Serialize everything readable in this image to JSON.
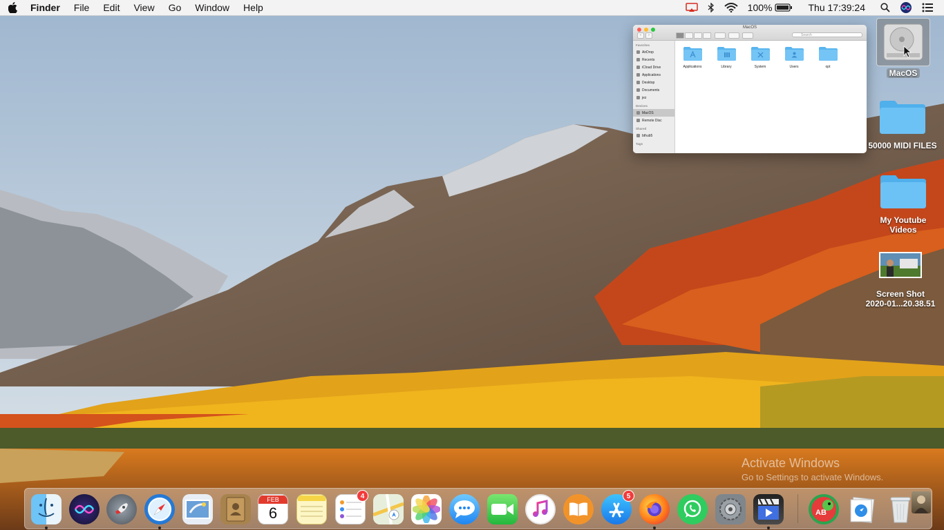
{
  "menubar": {
    "apple_icon": "apple-logo",
    "app_name": "Finder",
    "menus": [
      "File",
      "Edit",
      "View",
      "Go",
      "Window",
      "Help"
    ],
    "battery": "100%",
    "clock": "Thu 17:39:24",
    "status_icons": [
      "airplay-icon",
      "bluetooth-icon",
      "wifi-icon",
      "battery-icon",
      "spotlight-search-icon",
      "siri-icon"
    ]
  },
  "finder_window": {
    "title": "MacOS",
    "search_placeholder": "Search",
    "sidebar": {
      "favorites_header": "Favorites",
      "favorites": [
        "AirDrop",
        "Recents",
        "iCloud Drive",
        "Applications",
        "Desktop",
        "Documents",
        "jez"
      ],
      "devices_header": "Devices",
      "devices": [
        "MacOS",
        "Remote Disc"
      ],
      "shared_header": "Shared",
      "shared": [
        "bthub5"
      ],
      "tags_header": "Tags"
    },
    "items": [
      "Applications",
      "Library",
      "System",
      "Users",
      "opt"
    ]
  },
  "desktop": {
    "icons": [
      {
        "label": "MacOS",
        "icon": "hard-drive-icon"
      },
      {
        "label": "50000 MIDI FILES",
        "icon": "folder-icon"
      },
      {
        "label_line1": "My Youtube",
        "label_line2": "Videos",
        "icon": "folder-icon"
      },
      {
        "label_line1": "Screen Shot",
        "label_line2": "2020-01...20.38.51",
        "icon": "screenshot-thumbnail-icon"
      }
    ]
  },
  "watermark": {
    "line1": "Activate Windows",
    "line2": "Go to Settings to activate Windows."
  },
  "dock": {
    "apps": [
      {
        "name": "Finder",
        "icon": "finder-icon",
        "running": true
      },
      {
        "name": "Siri",
        "icon": "siri-icon"
      },
      {
        "name": "Launchpad",
        "icon": "launchpad-icon"
      },
      {
        "name": "Safari",
        "icon": "safari-icon",
        "running": true
      },
      {
        "name": "Mail",
        "icon": "mail-icon"
      },
      {
        "name": "Contacts",
        "icon": "contacts-icon"
      },
      {
        "name": "Calendar",
        "icon": "calendar-icon",
        "month": "FEB",
        "day": "6"
      },
      {
        "name": "Notes",
        "icon": "notes-icon"
      },
      {
        "name": "Reminders",
        "icon": "reminders-icon",
        "badge": "4"
      },
      {
        "name": "Maps",
        "icon": "maps-icon"
      },
      {
        "name": "Photos",
        "icon": "photos-icon"
      },
      {
        "name": "Messages",
        "icon": "messages-icon"
      },
      {
        "name": "FaceTime",
        "icon": "facetime-icon"
      },
      {
        "name": "iTunes",
        "icon": "itunes-icon"
      },
      {
        "name": "iBooks",
        "icon": "books-icon"
      },
      {
        "name": "App Store",
        "icon": "app-store-icon",
        "badge": "5"
      },
      {
        "name": "Firefox",
        "icon": "firefox-icon",
        "running": true
      },
      {
        "name": "WhatsApp",
        "icon": "whatsapp-icon"
      },
      {
        "name": "System Preferences",
        "icon": "system-preferences-icon"
      },
      {
        "name": "iMovie",
        "icon": "imovie-icon",
        "running": true
      },
      {
        "name": "Typing app",
        "icon": "typing-app-icon"
      },
      {
        "name": "Downloads",
        "icon": "downloads-stack-icon"
      },
      {
        "name": "Trash",
        "icon": "trash-icon"
      },
      {
        "name": "User stack",
        "icon": "user-stack-icon"
      }
    ]
  }
}
